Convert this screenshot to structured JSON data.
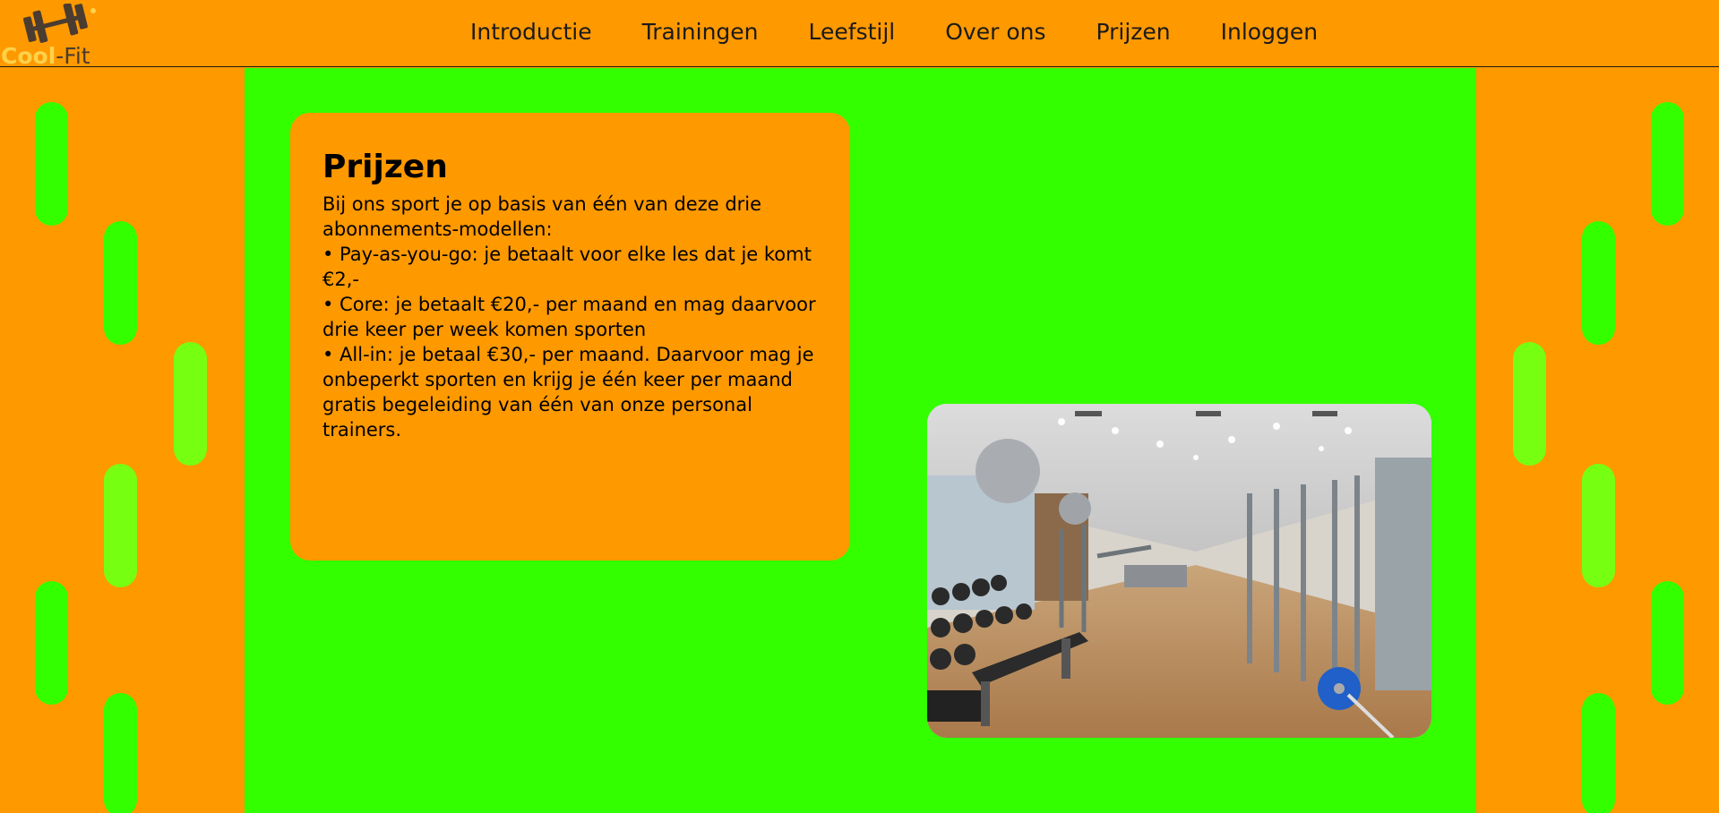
{
  "brand": {
    "cool": "Cool",
    "fit": "-Fit",
    "icon": "dumbbell-icon"
  },
  "nav": [
    {
      "label": "Introductie"
    },
    {
      "label": "Trainingen"
    },
    {
      "label": "Leefstijl"
    },
    {
      "label": "Over ons"
    },
    {
      "label": "Prijzen"
    },
    {
      "label": "Inloggen"
    }
  ],
  "content": {
    "title": "Prijzen",
    "intro": "Bij ons sport je op basis van één van deze drie abonnements-modellen:",
    "bullets": [
      "• Pay-as-you-go: je betaalt voor elke les dat je komt €2,-",
      "• Core: je betaalt €20,- per maand en mag daarvoor drie keer per week komen sporten",
      "• All-in: je betaal €30,- per maand. Daarvoor mag je onbeperkt sporten en krijg je één keer per maand gratis begeleiding van één van onze personal trainers."
    ]
  },
  "colors": {
    "orange": "#ff9900",
    "green": "#33ff00",
    "pill_green": "#33ff00",
    "pill_lime": "#77ff11",
    "logo_yellow": "#ffd24a"
  },
  "image": {
    "subject": "gym-interior-photo"
  }
}
